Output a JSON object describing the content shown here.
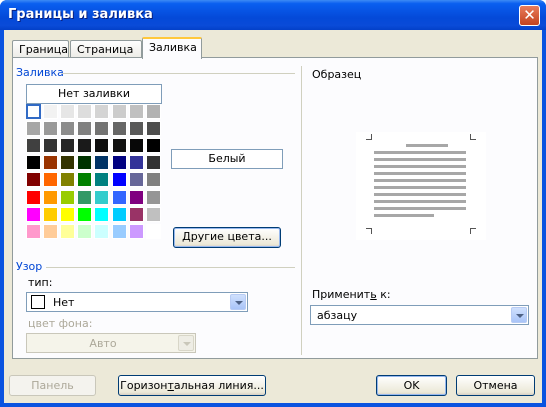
{
  "window": {
    "title": "Границы и заливка",
    "close_icon": "close-icon"
  },
  "tabs": [
    {
      "label": "Граница"
    },
    {
      "label": "Страница"
    },
    {
      "label": "Заливка",
      "active": true
    }
  ],
  "fill": {
    "group_label": "Заливка",
    "no_fill_label": "Нет заливки",
    "selected_color_name": "Белый",
    "more_colors_label": "Другие цвета...",
    "palette_rows": [
      [
        "#ffffff",
        "#f2f2f2",
        "#e6e6e6",
        "#dddddd",
        "#d4d4d4",
        "#cccccc",
        "#c0c0c0",
        "#b2b2b2"
      ],
      [
        "#a6a6a6",
        "#999999",
        "#8c8c8c",
        "#808080",
        "#737373",
        "#666666",
        "#595959",
        "#4d4d4d"
      ],
      [
        "#404040",
        "#333333",
        "#262626",
        "#1a1a1a",
        "#0d0d0d",
        "#111111",
        "#080808",
        "#000000"
      ],
      [
        "#000000",
        "#993300",
        "#333300",
        "#003300",
        "#003366",
        "#000080",
        "#333399",
        "#333333"
      ],
      [
        "#800000",
        "#ff6600",
        "#808000",
        "#008000",
        "#008080",
        "#0000ff",
        "#666699",
        "#808080"
      ],
      [
        "#ff0000",
        "#ff9900",
        "#99cc00",
        "#339966",
        "#33cccc",
        "#3366ff",
        "#800080",
        "#969696"
      ],
      [
        "#ff00ff",
        "#ffcc00",
        "#ffff00",
        "#00ff00",
        "#00ffff",
        "#00ccff",
        "#993366",
        "#c0c0c0"
      ],
      [
        "#ff99cc",
        "#ffcc99",
        "#ffff99",
        "#ccffcc",
        "#ccffff",
        "#99ccff",
        "#cc99ff",
        "#ffffff"
      ]
    ],
    "selected_swatch": [
      0,
      0
    ]
  },
  "pattern": {
    "group_label": "Узор",
    "type_label": "тип:",
    "type_value": "Нет",
    "bg_label": "цвет фона:",
    "bg_value": "Авто"
  },
  "sample": {
    "label": "Образец",
    "apply_label": "Применить к:",
    "apply_value": "абзацу"
  },
  "buttons": {
    "panel": "Панель",
    "horizontal_line": "Горизонтальная линия...",
    "ok": "OK",
    "cancel": "Отмена"
  }
}
